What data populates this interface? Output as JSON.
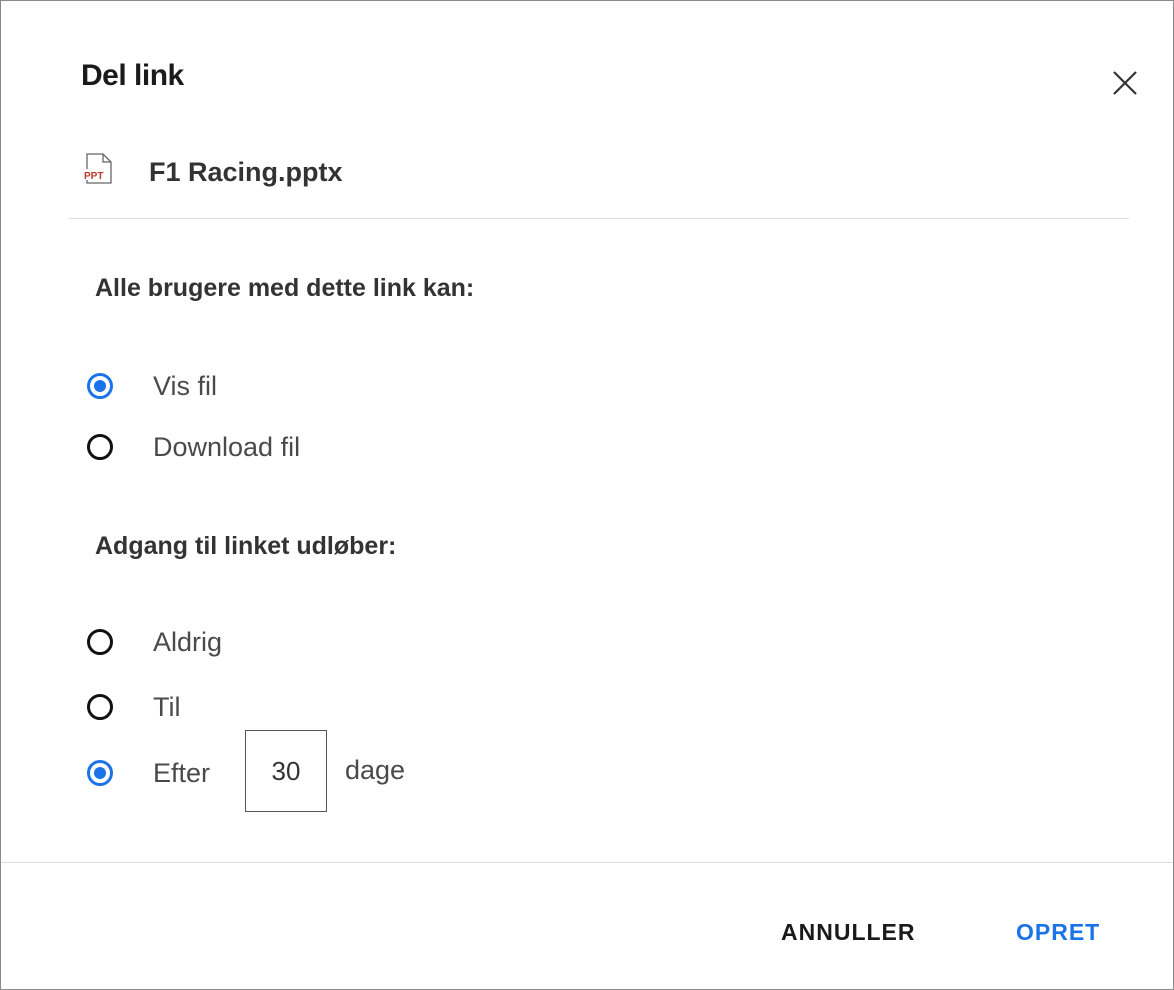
{
  "dialog": {
    "title": "Del link",
    "file": {
      "name": "F1 Racing.pptx",
      "icon": "ppt-file-icon",
      "icon_text": "PPT",
      "icon_color": "#c0392b"
    },
    "permissions": {
      "heading": "Alle brugere med dette link kan:",
      "options": [
        {
          "label": "Vis fil",
          "checked": true
        },
        {
          "label": "Download fil",
          "checked": false
        }
      ]
    },
    "expiry": {
      "heading": "Adgang til linket udløber:",
      "options": [
        {
          "label": "Aldrig",
          "checked": false
        },
        {
          "label": "Til",
          "checked": false
        },
        {
          "label": "Efter",
          "checked": true
        }
      ],
      "days_value": "30",
      "days_suffix": "dage"
    },
    "buttons": {
      "cancel": "ANNULLER",
      "create": "OPRET"
    },
    "colors": {
      "accent": "#1a73e8",
      "text": "#333333"
    }
  }
}
